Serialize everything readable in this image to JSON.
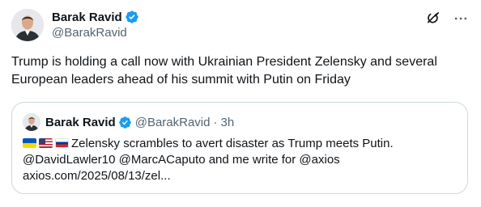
{
  "post": {
    "author": {
      "name": "Barak Ravid",
      "handle": "@BarakRavid"
    },
    "text": "Trump is holding a call now with Ukrainian President Zelensky and several European leaders ahead of his summit with Putin on Friday",
    "icons": {
      "verified": "verified-badge-icon",
      "grok": "grok-icon",
      "more": "more-options-icon"
    },
    "colors": {
      "text": "#0f1419",
      "secondary": "#536471",
      "verified": "#1d9bf0",
      "border": "#cfd9de"
    }
  },
  "quote": {
    "author": {
      "name": "Barak Ravid",
      "handle": "@BarakRavid",
      "separator": "·",
      "time": "3h"
    },
    "flags": [
      "ukraine-flag",
      "usa-flag",
      "russia-flag"
    ],
    "line1": "Zelensky scrambles to avert disaster as Trump meets Putin.",
    "line2": "@DavidLawler10 @MarcACaputo and me write for @axios",
    "line3": "axios.com/2025/08/13/zel..."
  }
}
